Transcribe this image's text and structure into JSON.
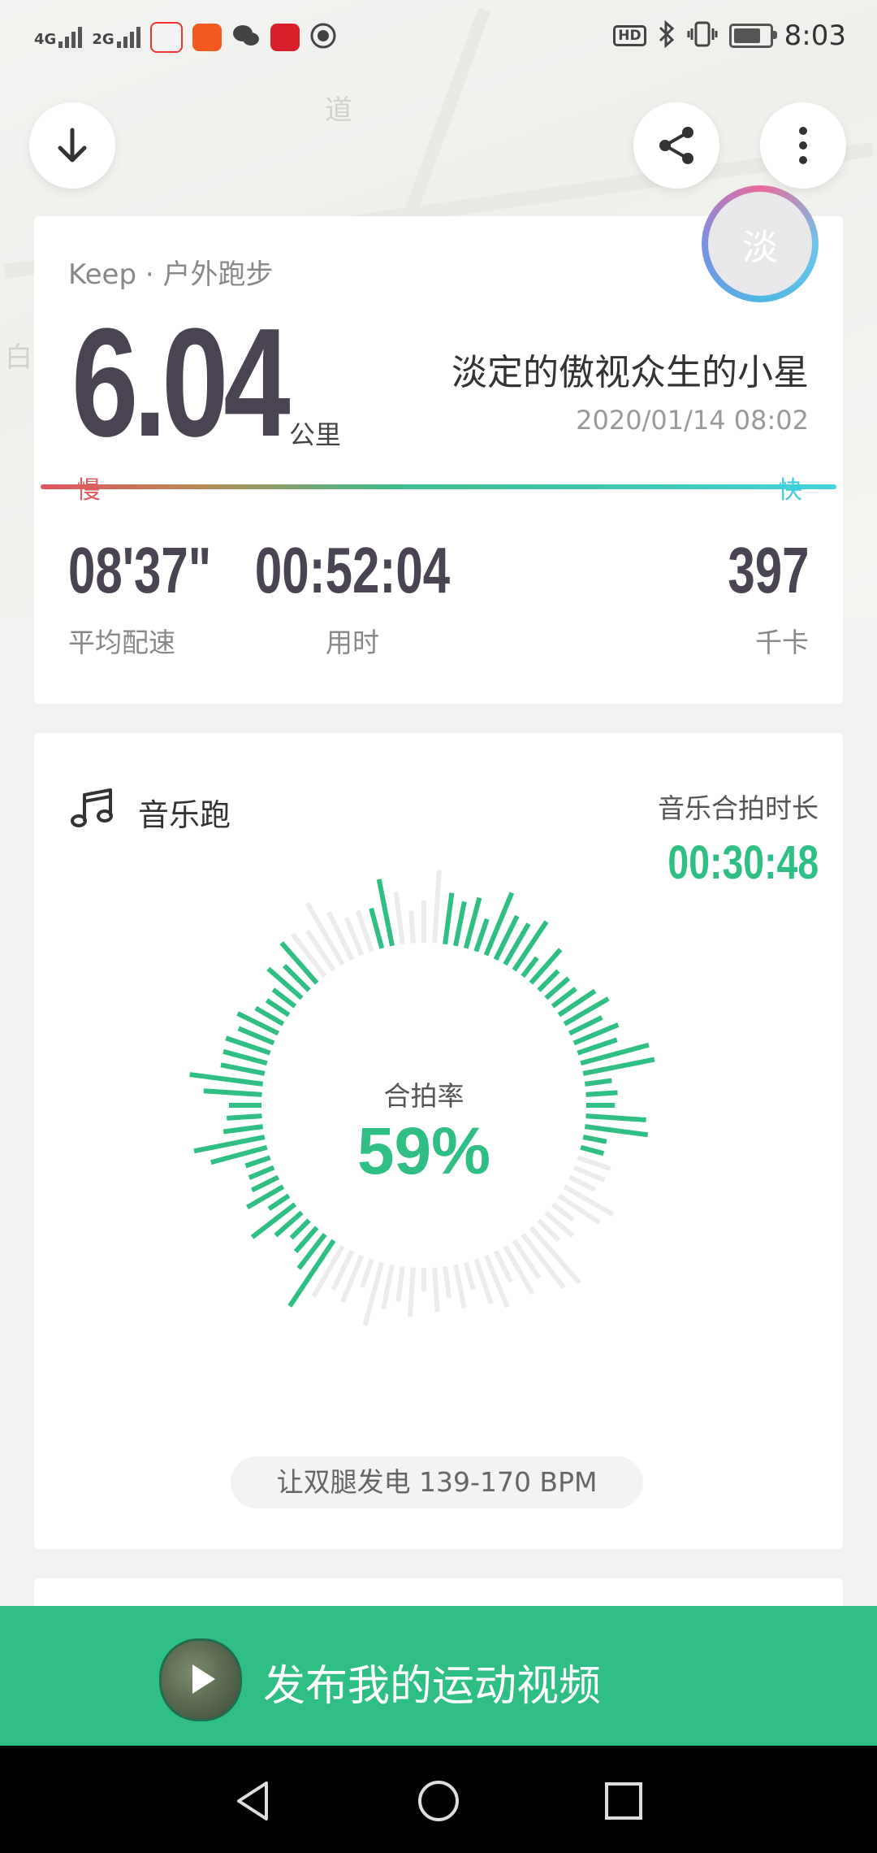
{
  "status_bar": {
    "net1": "4G",
    "net2": "2G",
    "hd": "HD",
    "time": "8:03"
  },
  "map": {
    "labels": [
      "道",
      "白"
    ]
  },
  "summary": {
    "source": "Keep · 户外跑步",
    "distance": "6.04",
    "distance_unit": "公里",
    "nickname": "淡定的傲视众生的小星",
    "datetime": "2020/01/14 08:02",
    "slow_label": "慢",
    "fast_label": "快",
    "stats": [
      {
        "value": "08'37\"",
        "label": "平均配速"
      },
      {
        "value": "00:52:04",
        "label": "用时"
      },
      {
        "value": "397",
        "label": "千卡"
      }
    ]
  },
  "avatar": {
    "initial": "淡"
  },
  "music": {
    "title": "音乐跑",
    "beat_label": "音乐合拍时长",
    "beat_value": "00:30:48",
    "rate_label": "合拍率",
    "rate_value": "59%",
    "bpm_text": "让双腿发电  139-170 BPM"
  },
  "publish": {
    "label": "发布我的运动视频"
  },
  "colors": {
    "accent": "#2fbf85",
    "dark": "#4a4352",
    "slow": "#e05a5e",
    "fast": "#3ccde0"
  }
}
